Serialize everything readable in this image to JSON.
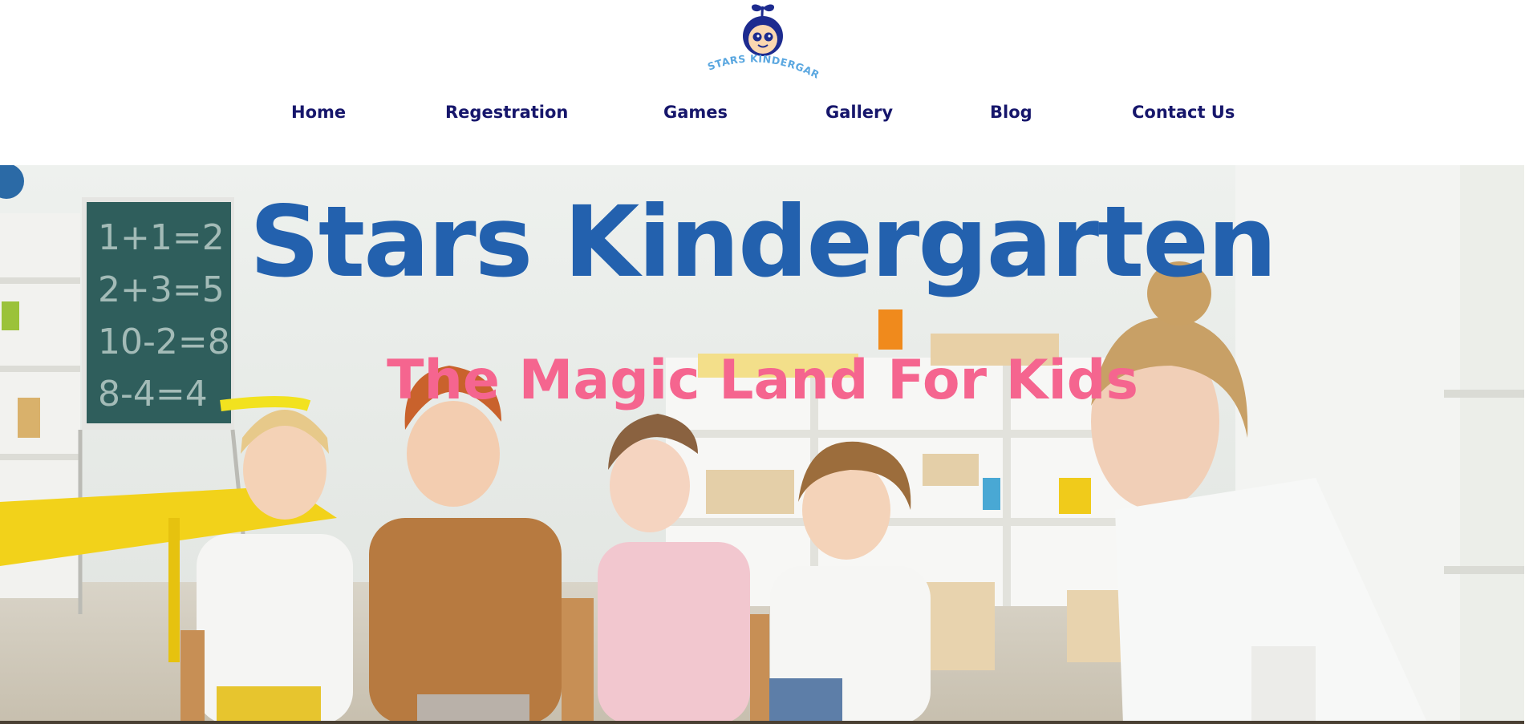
{
  "brand": {
    "logo_text": "STARS KINDERGARTEN",
    "colors": {
      "navy": "#16166b",
      "blue": "#2361ae",
      "pink": "#f5658f",
      "logo_light_blue": "#5aa7e0"
    }
  },
  "nav": {
    "items": [
      {
        "label": "Home"
      },
      {
        "label": "Regestration"
      },
      {
        "label": "Games"
      },
      {
        "label": "Gallery"
      },
      {
        "label": "Blog"
      },
      {
        "label": "Contact Us"
      }
    ]
  },
  "hero": {
    "title": "Stars Kindergarten",
    "subtitle": "The Magic Land For Kids",
    "chalkboard": {
      "lines": [
        "1+1=2",
        "2+3=5",
        "10-2=8",
        "8-4=4"
      ]
    }
  }
}
